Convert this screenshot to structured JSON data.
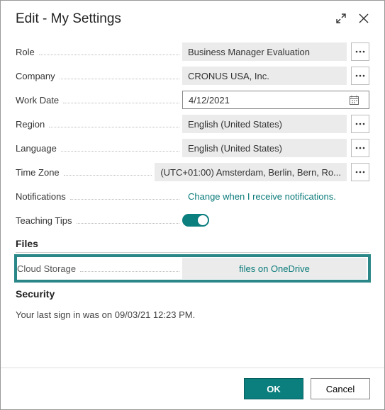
{
  "header": {
    "title": "Edit - My Settings"
  },
  "fields": {
    "role": {
      "label": "Role",
      "value": "Business Manager Evaluation"
    },
    "company": {
      "label": "Company",
      "value": "CRONUS USA, Inc."
    },
    "workdate": {
      "label": "Work Date",
      "value": "4/12/2021"
    },
    "region": {
      "label": "Region",
      "value": "English (United States)"
    },
    "language": {
      "label": "Language",
      "value": "English (United States)"
    },
    "timezone": {
      "label": "Time Zone",
      "value": "(UTC+01:00) Amsterdam, Berlin, Bern, Ro..."
    },
    "notifications": {
      "label": "Notifications",
      "link": "Change when I receive notifications."
    },
    "teaching": {
      "label": "Teaching Tips",
      "enabled": true
    }
  },
  "sections": {
    "files": "Files",
    "security": "Security"
  },
  "cloud": {
    "label": "Cloud Storage",
    "value": "files on OneDrive"
  },
  "security_text": "Your last sign in was on 09/03/21 12:23 PM.",
  "footer": {
    "ok": "OK",
    "cancel": "Cancel"
  }
}
